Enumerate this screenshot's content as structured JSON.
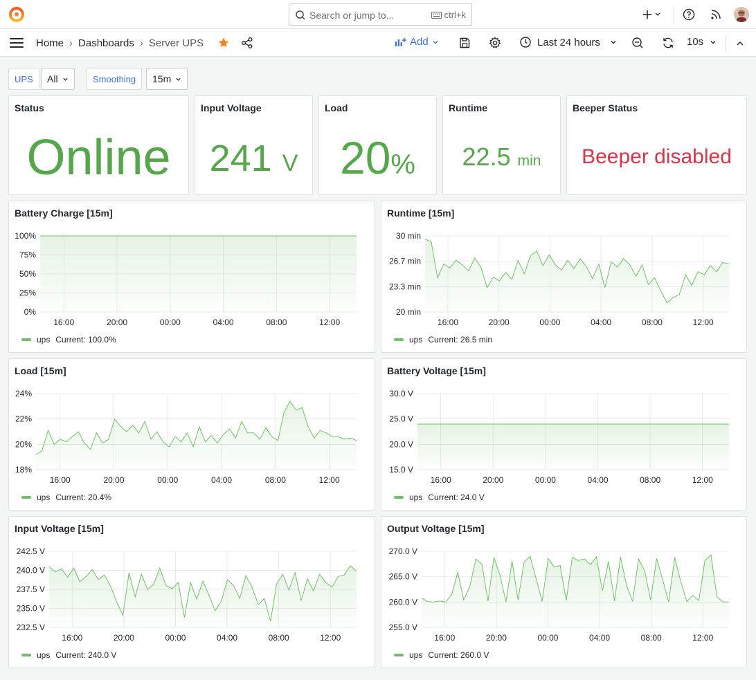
{
  "topbar": {
    "search_placeholder": "Search or jump to...",
    "search_shortcut": "ctrl+k",
    "icons": [
      "grafana-logo-icon",
      "search-icon",
      "keyboard-icon",
      "plus-icon",
      "help-icon",
      "rss-icon",
      "avatar"
    ]
  },
  "nav": {
    "breadcrumbs": [
      "Home",
      "Dashboards",
      "Server UPS"
    ],
    "add_label": "Add",
    "time_range": "Last 24 hours",
    "refresh_interval": "10s"
  },
  "variables": {
    "ups_label": "UPS",
    "ups_value": "All",
    "smoothing_label": "Smoothing",
    "smoothing_value": "15m"
  },
  "stats": {
    "status": {
      "title": "Status",
      "value": "Online",
      "color": "#56a64b"
    },
    "input_voltage": {
      "title": "Input Voltage",
      "value": "241",
      "unit": "V",
      "color": "#56a64b"
    },
    "load": {
      "title": "Load",
      "value": "20",
      "unit": "%",
      "color": "#56a64b"
    },
    "runtime": {
      "title": "Runtime",
      "value": "22.5",
      "unit": "min",
      "color": "#56a64b"
    },
    "beeper": {
      "title": "Beeper Status",
      "value": "Beeper disabled",
      "color": "#d63649"
    }
  },
  "chart_data": [
    {
      "type": "line",
      "title": "Battery Charge [15m]",
      "x_ticks": [
        "16:00",
        "20:00",
        "00:00",
        "04:00",
        "08:00",
        "12:00"
      ],
      "y_ticks": [
        "100%",
        "75%",
        "50%",
        "25%",
        "0%"
      ],
      "ylim": [
        0,
        100
      ],
      "series": [
        {
          "name": "ups",
          "values": [
            100,
            100,
            100,
            100,
            100,
            100,
            100,
            100,
            100,
            100,
            100,
            100,
            100,
            100,
            100,
            100,
            100,
            100,
            100,
            100,
            100,
            100,
            100,
            100
          ],
          "color": "#73bf69"
        }
      ],
      "legend": {
        "name": "ups",
        "current": "Current: 100.0%"
      }
    },
    {
      "type": "line",
      "title": "Runtime [15m]",
      "x_ticks": [
        "16:00",
        "20:00",
        "00:00",
        "04:00",
        "08:00",
        "12:00"
      ],
      "y_ticks": [
        "30 min",
        "26.7 min",
        "23.3 min",
        "20 min"
      ],
      "ylim": [
        20,
        30
      ],
      "series": [
        {
          "name": "ups",
          "values": [
            29.6,
            29.2,
            24.5,
            26.3,
            25.8,
            26.8,
            26.2,
            25.4,
            27.1,
            25.9,
            23.2,
            24.6,
            24.1,
            25.2,
            24.3,
            26.8,
            25.0,
            27.4,
            28.0,
            26.1,
            27.5,
            26.2,
            25.5,
            26.8,
            25.7,
            27.0,
            26.0,
            24.4,
            26.3,
            23.2,
            26.6,
            25.9,
            27.0,
            26.2,
            24.7,
            26.2,
            23.6,
            24.5,
            22.8,
            21.2,
            21.9,
            22.3,
            24.9,
            23.5,
            25.3,
            24.9,
            26.1,
            25.3,
            26.5,
            26.3
          ],
          "color": "#73bf69"
        }
      ],
      "legend": {
        "name": "ups",
        "current": "Current: 26.5 min"
      }
    },
    {
      "type": "line",
      "title": "Load [15m]",
      "x_ticks": [
        "16:00",
        "20:00",
        "00:00",
        "04:00",
        "08:00",
        "12:00"
      ],
      "y_ticks": [
        "24%",
        "22%",
        "20%",
        "18%"
      ],
      "ylim": [
        18,
        24
      ],
      "series": [
        {
          "name": "ups",
          "values": [
            19.2,
            19.5,
            21.1,
            20.0,
            20.4,
            20.2,
            20.6,
            21.0,
            20.1,
            19.6,
            20.9,
            20.1,
            20.4,
            22.0,
            21.4,
            21.0,
            21.5,
            20.9,
            21.8,
            20.4,
            21.0,
            20.2,
            19.8,
            20.6,
            20.2,
            20.9,
            19.8,
            21.4,
            20.2,
            20.7,
            20.1,
            20.8,
            21.2,
            20.5,
            21.8,
            20.9,
            20.9,
            20.4,
            21.3,
            20.6,
            20.3,
            22.5,
            23.4,
            22.7,
            22.9,
            21.4,
            20.5,
            21.1,
            20.9,
            20.6,
            20.6,
            20.4,
            20.5,
            20.3
          ],
          "color": "#73bf69"
        }
      ],
      "legend": {
        "name": "ups",
        "current": "Current: 20.4%"
      }
    },
    {
      "type": "line",
      "title": "Battery Voltage [15m]",
      "x_ticks": [
        "16:00",
        "20:00",
        "00:00",
        "04:00",
        "08:00",
        "12:00"
      ],
      "y_ticks": [
        "30.0 V",
        "25.0 V",
        "20.0 V",
        "15.0 V"
      ],
      "ylim": [
        15,
        30
      ],
      "series": [
        {
          "name": "ups",
          "values": [
            24,
            24,
            24,
            24,
            24,
            24,
            24,
            24,
            24,
            24,
            24,
            24,
            24,
            24,
            24,
            24,
            24,
            24,
            24,
            24
          ],
          "color": "#73bf69"
        }
      ],
      "legend": {
        "name": "ups",
        "current": "Current: 24.0 V"
      }
    },
    {
      "type": "line",
      "title": "Input Voltage [15m]",
      "x_ticks": [
        "16:00",
        "20:00",
        "00:00",
        "04:00",
        "08:00",
        "12:00"
      ],
      "y_ticks": [
        "242.5 V",
        "240.0 V",
        "237.5 V",
        "235.0 V",
        "232.5 V"
      ],
      "ylim": [
        232.5,
        242.5
      ],
      "series": [
        {
          "name": "ups",
          "values": [
            240.5,
            239.8,
            240.2,
            239.1,
            240.3,
            238.5,
            239.2,
            240.1,
            238.8,
            239.4,
            237.9,
            235.8,
            234.1,
            239.7,
            236.5,
            239.5,
            237.5,
            238.2,
            240.3,
            238.0,
            237.6,
            238.4,
            233.8,
            238.4,
            236.2,
            238.6,
            236.7,
            234.7,
            235.9,
            238.8,
            238.0,
            236.3,
            239.3,
            237.8,
            235.5,
            236.3,
            233.3,
            238.2,
            239.5,
            237.4,
            239.7,
            236.0,
            238.9,
            237.3,
            239.5,
            238.4,
            237.8,
            239.2,
            239.4,
            240.6,
            239.9
          ],
          "color": "#73bf69"
        }
      ],
      "legend": {
        "name": "ups",
        "current": "Current: 240.0 V"
      }
    },
    {
      "type": "line",
      "title": "Output Voltage [15m]",
      "x_ticks": [
        "16:00",
        "20:00",
        "00:00",
        "04:00",
        "08:00",
        "12:00"
      ],
      "y_ticks": [
        "270.0 V",
        "265.0 V",
        "260.0 V",
        "255.0 V"
      ],
      "ylim": [
        255,
        270
      ],
      "series": [
        {
          "name": "ups",
          "values": [
            260.8,
            260.1,
            260.0,
            260.2,
            260.0,
            261.5,
            265.9,
            260.4,
            263.1,
            268.5,
            267.5,
            260.2,
            268.8,
            265.3,
            260.0,
            268.1,
            260.4,
            267.9,
            269.0,
            264.6,
            260.1,
            268.6,
            266.9,
            267.2,
            260.3,
            268.8,
            268.2,
            268.5,
            267.4,
            268.9,
            262.2,
            268.0,
            260.2,
            268.9,
            263.3,
            260.1,
            268.5,
            266.2,
            260.4,
            268.6,
            264.4,
            260.0,
            268.8,
            264.0,
            260.1,
            261.3,
            260.3,
            268.2,
            269.3,
            261.0,
            260.0,
            260.0
          ],
          "color": "#73bf69"
        }
      ],
      "legend": {
        "name": "ups",
        "current": "Current: 260.0 V"
      }
    }
  ]
}
